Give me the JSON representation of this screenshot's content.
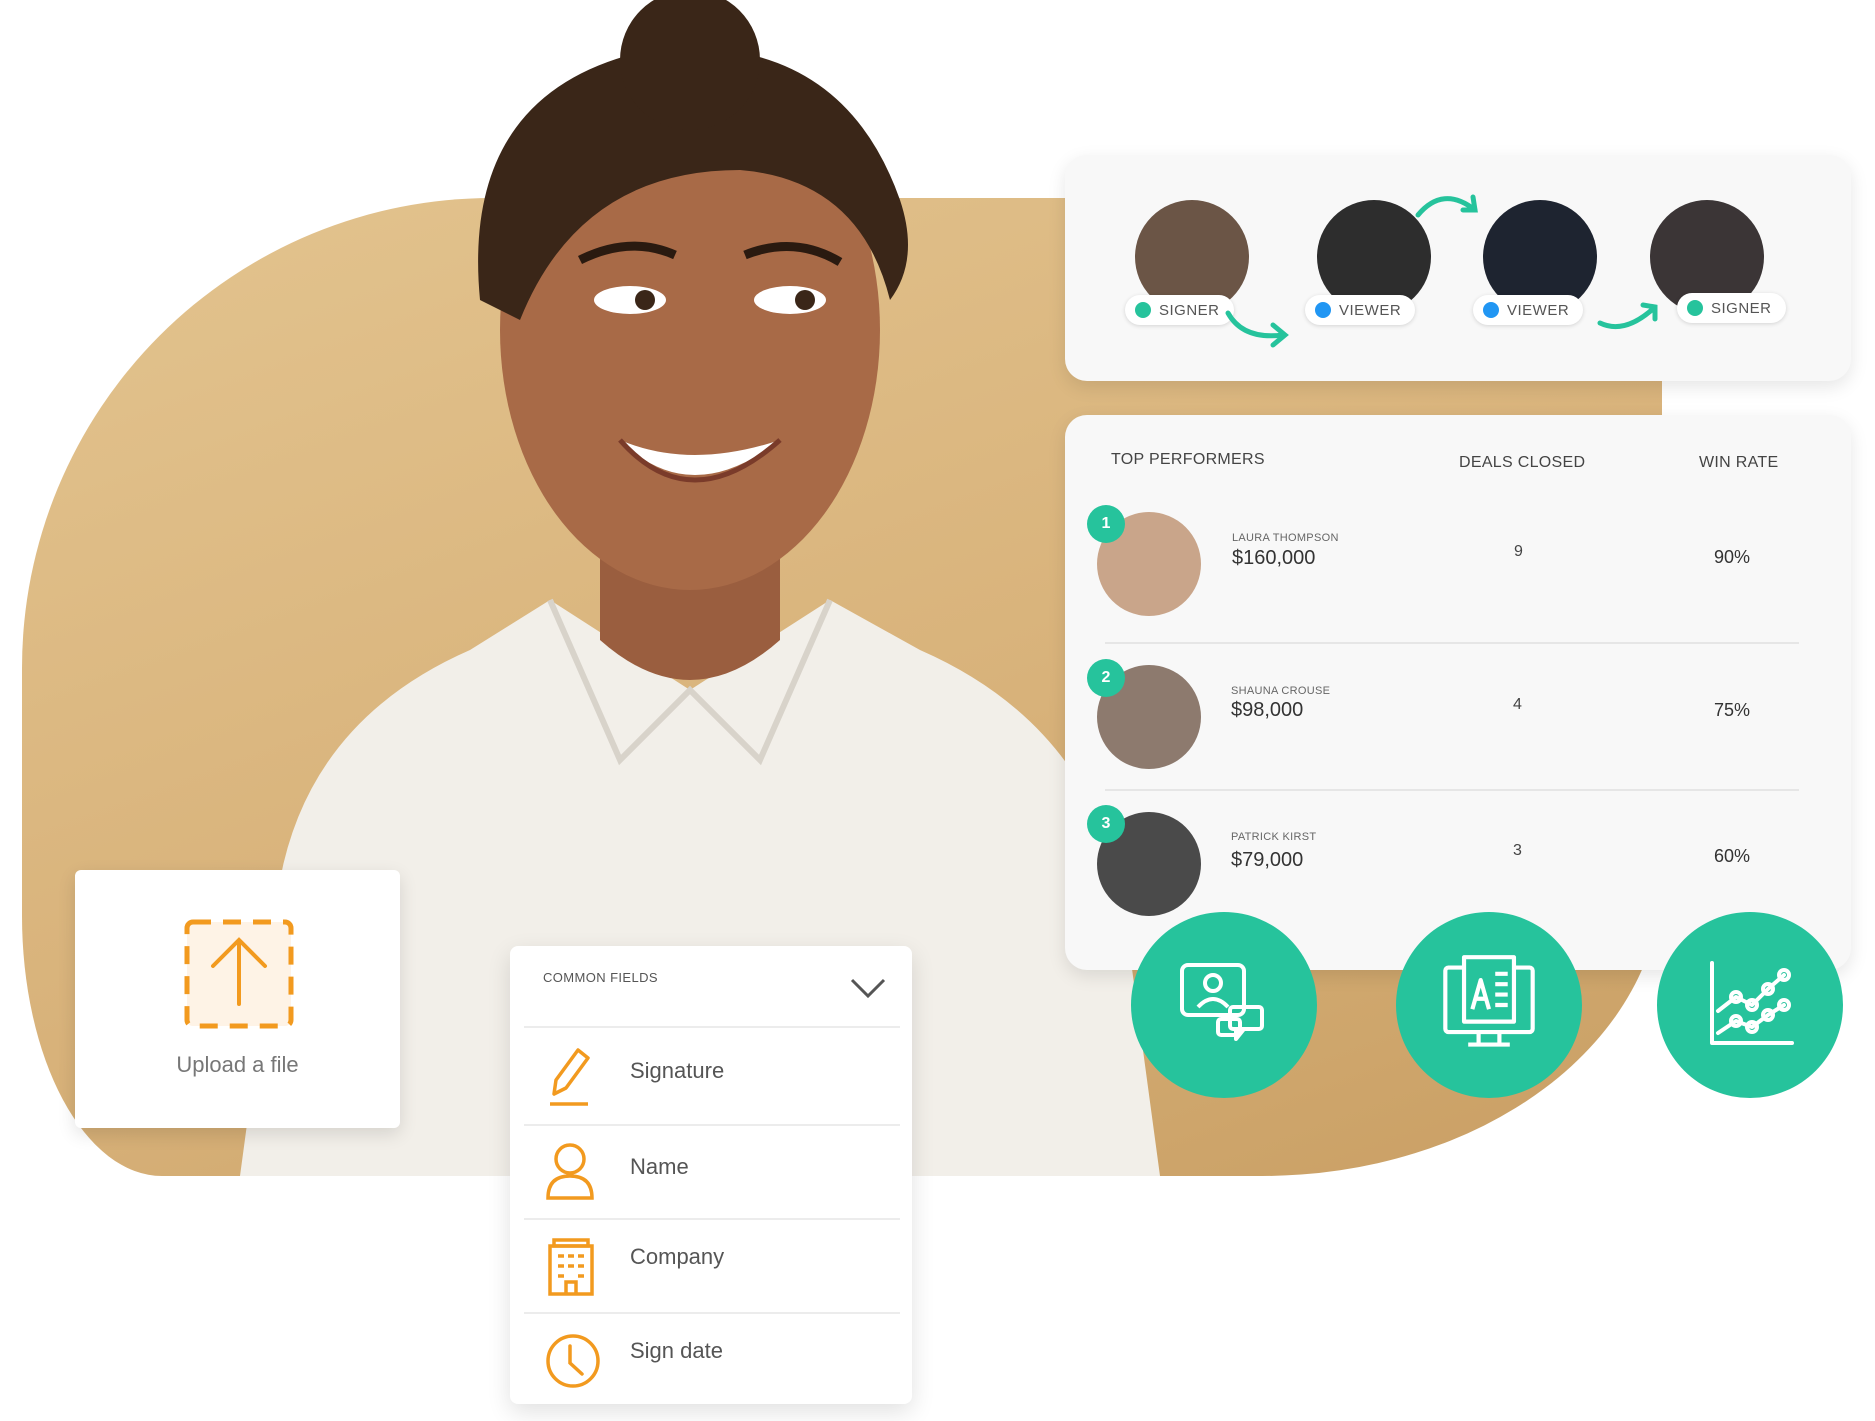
{
  "colors": {
    "accent": "#26c39c",
    "viewer": "#2196f3",
    "field_icon": "#f29a1f",
    "background_blob": "#d8b27a"
  },
  "workflow": {
    "steps": [
      {
        "role": "SIGNER",
        "status_color": "#26c39c"
      },
      {
        "role": "VIEWER",
        "status_color": "#2196f3"
      },
      {
        "role": "VIEWER",
        "status_color": "#2196f3"
      },
      {
        "role": "SIGNER",
        "status_color": "#26c39c"
      }
    ]
  },
  "performers": {
    "headers": {
      "top_performers": "TOP PERFORMERS",
      "deals_closed": "DEALS CLOSED",
      "win_rate": "WIN RATE"
    },
    "rows": [
      {
        "rank": "1",
        "name": "LAURA THOMPSON",
        "amount": "$160,000",
        "deals": "9",
        "win_rate": "90%"
      },
      {
        "rank": "2",
        "name": "SHAUNA CROUSE",
        "amount": "$98,000",
        "deals": "4",
        "win_rate": "75%"
      },
      {
        "rank": "3",
        "name": "PATRICK KIRST",
        "amount": "$79,000",
        "deals": "3",
        "win_rate": "60%"
      }
    ]
  },
  "features": {
    "icons": [
      "user-chat-icon",
      "document-screen-icon",
      "line-chart-icon"
    ]
  },
  "upload": {
    "label": "Upload a file",
    "icon": "upload-arrow-icon"
  },
  "common_fields": {
    "title": "COMMON FIELDS",
    "items": [
      {
        "label": "Signature",
        "icon": "pen-icon"
      },
      {
        "label": "Name",
        "icon": "person-icon"
      },
      {
        "label": "Company",
        "icon": "building-icon"
      },
      {
        "label": "Sign date",
        "icon": "clock-icon"
      }
    ]
  }
}
